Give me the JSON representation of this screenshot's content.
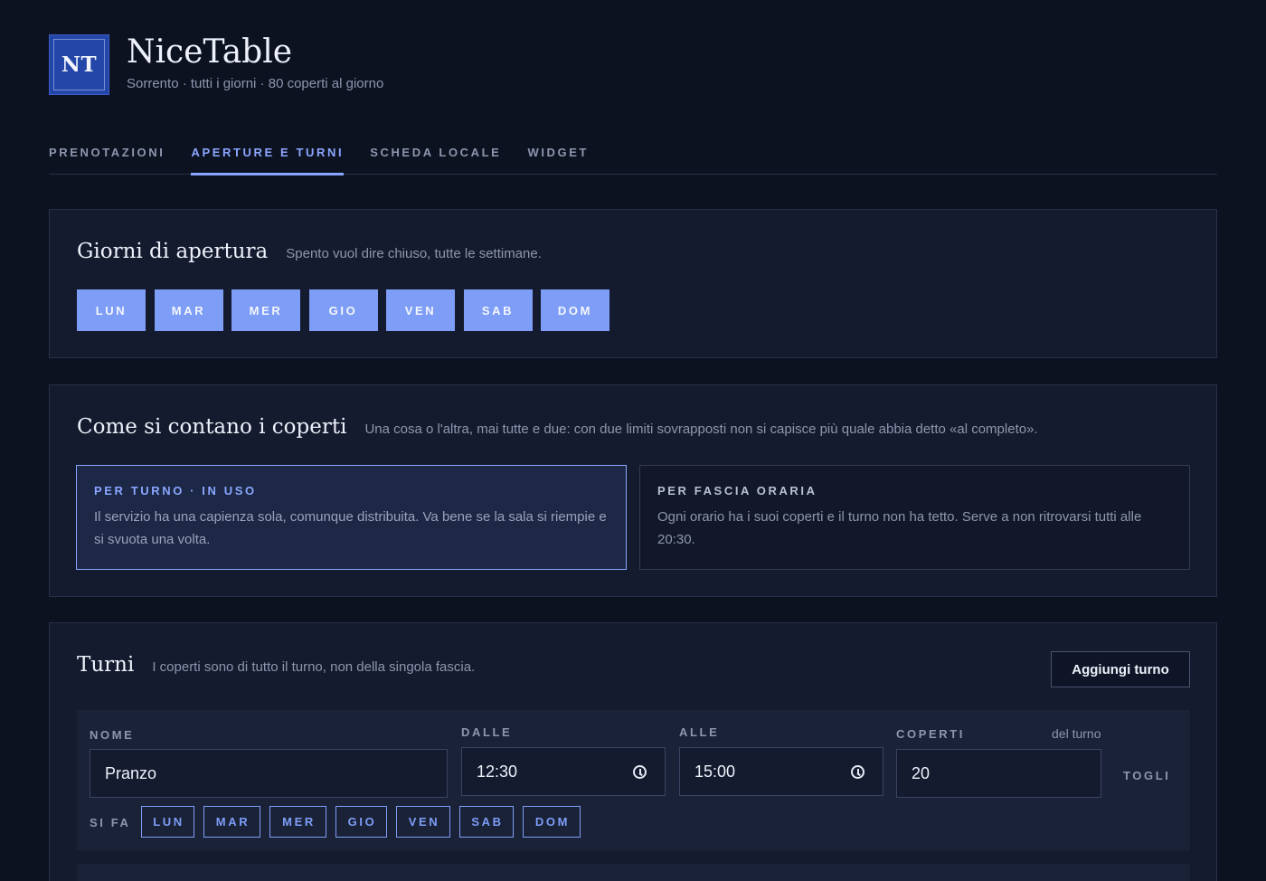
{
  "app": {
    "logo": "NT",
    "name": "NiceTable",
    "subtitle": "Sorrento · tutti i giorni · 80 coperti al giorno"
  },
  "tabs": [
    {
      "label": "PRENOTAZIONI",
      "active": false
    },
    {
      "label": "APERTURE E TURNI",
      "active": true
    },
    {
      "label": "SCHEDA LOCALE",
      "active": false
    },
    {
      "label": "WIDGET",
      "active": false
    }
  ],
  "opening": {
    "title": "Giorni di apertura",
    "description": "Spento vuol dire chiuso, tutte le settimane.",
    "days": [
      "LUN",
      "MAR",
      "MER",
      "GIO",
      "VEN",
      "SAB",
      "DOM"
    ]
  },
  "counting": {
    "title": "Come si contano i coperti",
    "description": "Una cosa o l'altra, mai tutte e due: con due limiti sovrapposti non si capisce più quale abbia detto «al completo».",
    "options": [
      {
        "title": "PER TURNO · IN USO",
        "text": "Il servizio ha una capienza sola, comunque distribuita. Va bene se la sala si riempie e si svuota una volta.",
        "active": true
      },
      {
        "title": "PER FASCIA ORARIA",
        "text": "Ogni orario ha i suoi coperti e il turno non ha tetto. Serve a non ritrovarsi tutti alle 20:30.",
        "active": false
      }
    ]
  },
  "shifts": {
    "title": "Turni",
    "description": "I coperti sono di tutto il turno, non della singola fascia.",
    "add_label": "Aggiungi turno",
    "labels": {
      "name": "NOME",
      "from": "DALLE",
      "to": "ALLE",
      "covers": "COPERTI",
      "covers_hint": "del turno",
      "remove": "TOGLI",
      "days": "SI FA"
    },
    "items": [
      {
        "name": "Pranzo",
        "from": "12:30",
        "to": "15:00",
        "covers": "20",
        "days": [
          "LUN",
          "MAR",
          "MER",
          "GIO",
          "VEN",
          "SAB",
          "DOM"
        ]
      }
    ]
  }
}
